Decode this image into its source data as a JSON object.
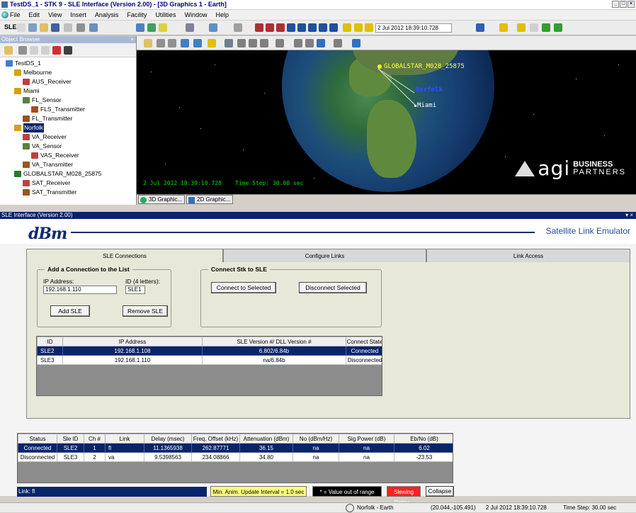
{
  "window": {
    "title": "TestDS_1 - STK 9 - SLE Interface (Version 2.00) - [3D Graphics 1 - Earth]",
    "min": "_",
    "max": "□",
    "close": "×"
  },
  "menu": [
    "File",
    "Edit",
    "View",
    "Insert",
    "Analysis",
    "Facility",
    "Utilities",
    "Window",
    "Help"
  ],
  "toolbar": {
    "sle_label": "SLE",
    "time": "2 Jul 2012 18:39:10.728"
  },
  "object_browser": {
    "title": "Object Browser",
    "items": [
      {
        "label": "TestDS_1",
        "level": 0,
        "icon": "scenario-icon",
        "color": "#3a7fd0"
      },
      {
        "label": "Melbourne",
        "level": 1,
        "icon": "facility-icon",
        "color": "#d4a017"
      },
      {
        "label": "AUS_Receiver",
        "level": 2,
        "icon": "receiver-icon",
        "color": "#c04040"
      },
      {
        "label": "Miami",
        "level": 1,
        "icon": "facility-icon",
        "color": "#d4a017"
      },
      {
        "label": "FL_Sensor",
        "level": 2,
        "icon": "sensor-icon",
        "color": "#5a7f3f"
      },
      {
        "label": "FLS_Transmitter",
        "level": 3,
        "icon": "transmitter-icon",
        "color": "#a05020"
      },
      {
        "label": "FL_Transmitter",
        "level": 2,
        "icon": "transmitter-icon",
        "color": "#a05020"
      },
      {
        "label": "Norfolk",
        "level": 1,
        "icon": "facility-icon",
        "color": "#d4a017",
        "selected": true
      },
      {
        "label": "VA_Receiver",
        "level": 2,
        "icon": "receiver-icon",
        "color": "#c04040"
      },
      {
        "label": "VA_Sensor",
        "level": 2,
        "icon": "sensor-icon",
        "color": "#5a7f3f"
      },
      {
        "label": "VAS_Receiver",
        "level": 3,
        "icon": "receiver-icon",
        "color": "#c04040"
      },
      {
        "label": "VA_Transmitter",
        "level": 2,
        "icon": "transmitter-icon",
        "color": "#a05020"
      },
      {
        "label": "GLOBALSTAR_M028_25875",
        "level": 1,
        "icon": "satellite-icon",
        "color": "#2a7a2a"
      },
      {
        "label": "SAT_Receiver",
        "level": 2,
        "icon": "receiver-icon",
        "color": "#c04040"
      },
      {
        "label": "SAT_Transmitter",
        "level": 2,
        "icon": "transmitter-icon",
        "color": "#a05020"
      }
    ]
  },
  "viewport": {
    "sat_label": "GLOBALSTAR_M028_25875",
    "norfolk_label": "Norfolk",
    "miami_label": "Miami",
    "time": "2 Jul 2012 18:39:10.728",
    "step": "Time Step: 30.00 sec",
    "logo_word": "agi",
    "logo_tag_1": "BUSINESS",
    "logo_tag_2": "PARTNERS"
  },
  "gfx_tabs": [
    "3D Graphic...",
    "2D Graphic..."
  ],
  "sle": {
    "window_title": "SLE Interface (Version 2.00)",
    "logo": "dBm",
    "product_name": "Satellite Link Emulator",
    "tabs": [
      "SLE Connections",
      "Configure Links",
      "Link Access"
    ],
    "add_group": {
      "title": "Add a Connection to the List",
      "ip_label": "IP Address:",
      "id_label": "ID (4 letters):",
      "ip_value": "192.168.1.110",
      "id_value": "SLE1",
      "add_button": "Add SLE",
      "remove_button": "Remove SLE"
    },
    "connect_group": {
      "title": "Connect Stk to SLE",
      "connect_button": "Connect to Selected",
      "disconnect_button": "Disconnect Selected"
    },
    "connections": {
      "headers": [
        "ID",
        "IP Address",
        "SLE Version #/ DLL Version #",
        "Connect State"
      ],
      "rows": [
        [
          "SLE2",
          "192.168.1.108",
          "6.802/6.84b",
          "Connected"
        ],
        [
          "SLE3",
          "192.168.1.110",
          "na/6.84b",
          "Disconnected"
        ]
      ]
    },
    "links": {
      "headers": [
        "Status",
        "Sle ID",
        "Ch #",
        "Link",
        "Delay (msec)",
        "Freq. Offset (kHz)",
        "Attenuation (dBm)",
        "No (dBm/Hz)",
        "Sig Power (dB)",
        "Eb/No (dB)"
      ],
      "rows": [
        [
          "Connected",
          "SLE2",
          "1",
          "fl",
          "11.1365938",
          "262.87771",
          "36.15",
          "na",
          "na",
          "6.02"
        ],
        [
          "Disconnected",
          "SLE3",
          "2",
          "va",
          "9.5398563",
          "234.08866",
          "34.80",
          "na",
          "na",
          "-23.53"
        ]
      ]
    },
    "status_text": "Link: fl",
    "min_update": "Min. Anim. Update Interval = 1.0 sec",
    "out_of_range": "* = Value out of range",
    "slewing": "Slewing Delay...",
    "collapse": "Collapse"
  },
  "statusbar": {
    "object": "Norfolk - Earth",
    "coords": "(20.044,-105.491)",
    "time": "2 Jul 2012 18:39:10.728",
    "step": "Time Step: 30.00 sec"
  },
  "colors": {
    "selection": "#0a246a",
    "brand": "#0d2a74",
    "slewing": "#ff2020",
    "min_update_bg": "#ffff80"
  }
}
